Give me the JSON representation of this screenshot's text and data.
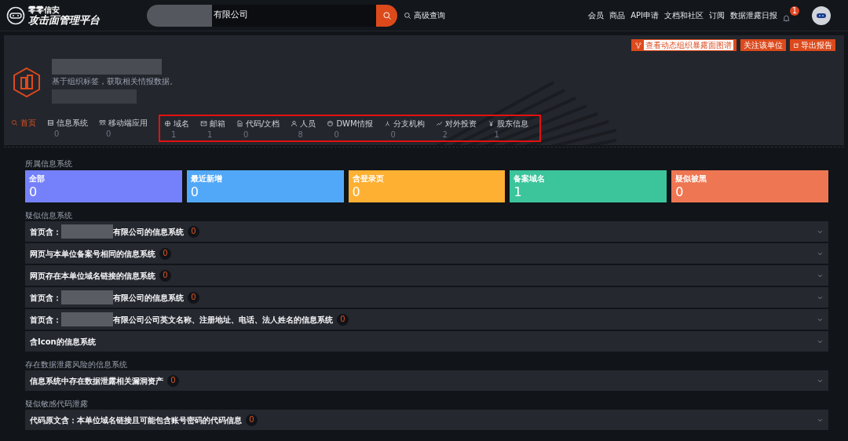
{
  "header": {
    "logo_line1": "零零信安",
    "logo_line2": "攻击面管理平台",
    "search": {
      "value": "有限公司",
      "redacted": true
    },
    "advanced_search": "高级查询",
    "links": [
      "会员",
      "商品",
      "API申请",
      "文档和社区",
      "订阅",
      "数据泄露日报"
    ],
    "notification_count": "1"
  },
  "hero": {
    "subtitle": "基于组织标签，获取相关情报数据。",
    "buttons": [
      {
        "kind": "graph",
        "label": "查看动态组织暴露面图谱"
      },
      {
        "kind": "plain",
        "label": "关注该单位"
      },
      {
        "kind": "export",
        "label": "导出报告"
      }
    ]
  },
  "nav": {
    "items": [
      {
        "label": "首页",
        "selected": true
      },
      {
        "label": "信息系统",
        "count": "0",
        "selected": false
      },
      {
        "label": "移动端应用",
        "count": "0",
        "selected": false
      }
    ],
    "boxed_items": [
      {
        "label": "域名",
        "count": "1",
        "selected": false
      },
      {
        "label": "邮箱",
        "count": "1",
        "selected": false
      },
      {
        "label": "代码/文档",
        "count": "0",
        "selected": false
      },
      {
        "label": "人员",
        "count": "8",
        "selected": false
      },
      {
        "label": "DWM情报",
        "count": "0",
        "selected": false
      },
      {
        "label": "分支机构",
        "count": "0",
        "selected": false
      },
      {
        "label": "对外投资",
        "count": "2",
        "selected": false
      },
      {
        "label": "股东信息",
        "count": "1",
        "selected": false
      }
    ]
  },
  "stats": {
    "title": "所属信息系统",
    "cards": [
      {
        "label": "全部",
        "value": "0",
        "color": "#7581fb"
      },
      {
        "label": "最近新增",
        "value": "0",
        "color": "#52a8f8"
      },
      {
        "label": "含登录页",
        "value": "0",
        "color": "#fdb032"
      },
      {
        "label": "备案域名",
        "value": "1",
        "color": "#3cc49b"
      },
      {
        "label": "疑似被黑",
        "value": "0",
        "color": "#ee7652"
      }
    ]
  },
  "sections": [
    {
      "title": "疑似信息系统",
      "rows": [
        {
          "prefix": "首页含：",
          "redacted": true,
          "text": "有限公司的信息系统",
          "count": "0"
        },
        {
          "redacted": false,
          "text": "网页与本单位备案号相同的信息系统",
          "count": "0"
        },
        {
          "redacted": false,
          "text": "网页存在本单位域名链接的信息系统",
          "count": "0"
        },
        {
          "prefix": "首页含：",
          "redacted": true,
          "text": "有限公司的信息系统",
          "count": "0"
        },
        {
          "prefix": "首页含：",
          "redacted": true,
          "text": "有限公司公司英文名称、注册地址、电话、法人姓名的信息系统",
          "count": "0"
        },
        {
          "redacted": false,
          "text": "含Icon的信息系统"
        }
      ]
    },
    {
      "title": "存在数据泄露风险的信息系统",
      "rows": [
        {
          "redacted": false,
          "text": "信息系统中存在数据泄露相关漏洞资产",
          "count": "0"
        }
      ]
    },
    {
      "title": "疑似敏感代码泄露",
      "rows": [
        {
          "redacted": false,
          "text": "代码原文含：本单位域名链接且可能包含账号密码的代码信息",
          "count": "0"
        }
      ]
    }
  ]
}
